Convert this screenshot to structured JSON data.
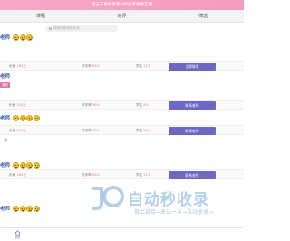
{
  "banner": {
    "text": "点击下载找家教APP找家教更方便"
  },
  "tabs": [
    {
      "label": "课程"
    },
    {
      "label": "好评"
    },
    {
      "label": "筛选"
    }
  ],
  "search": {
    "placeholder": "搜索你想找的老师"
  },
  "tutors": [
    {
      "name": "老师",
      "note": "",
      "badge": "",
      "stats": {
        "price_label": "价格",
        "price": "180元",
        "rating_label": "好评率",
        "rating": "95%",
        "count_label": "学生",
        "count": "12人"
      },
      "button": "立即联系"
    },
    {
      "name": "老师",
      "note": "",
      "badge": "高校",
      "stats": {
        "price_label": "价格",
        "price": "150元",
        "rating_label": "好评率",
        "rating": "98%",
        "count_label": "学生",
        "count": "8人"
      },
      "button": "联系老师"
    },
    {
      "name": "老师",
      "note": "",
      "badge": "",
      "stats": {
        "price_label": "价格",
        "price": "200元",
        "rating_label": "好评率",
        "rating": "99%",
        "count_label": "学生",
        "count": "20人"
      },
      "button": "联系老师"
    },
    {
      "name": "老师",
      "note": "一对一",
      "badge": "",
      "stats": {
        "price_label": "价格",
        "price": "160元",
        "rating_label": "好评率",
        "rating": "96%",
        "count_label": "学生",
        "count": "15人"
      },
      "button": "联系老师"
    },
    {
      "name": "老师",
      "note": "",
      "badge": "",
      "stats": {
        "price_label": "价格",
        "price": "170元",
        "rating_label": "好评率",
        "rating": "97%",
        "count_label": "学生",
        "count": "10人"
      },
      "button": "联系老师"
    }
  ],
  "watermark": {
    "title": "自动秒收录",
    "subtitle": "做上链接→来访一次→自动收录→"
  },
  "bottom_nav": {
    "home_label": "首页"
  },
  "colors": {
    "accent": "#6c69c4",
    "pink": "#e56aa5",
    "name": "#3d5ea8"
  }
}
